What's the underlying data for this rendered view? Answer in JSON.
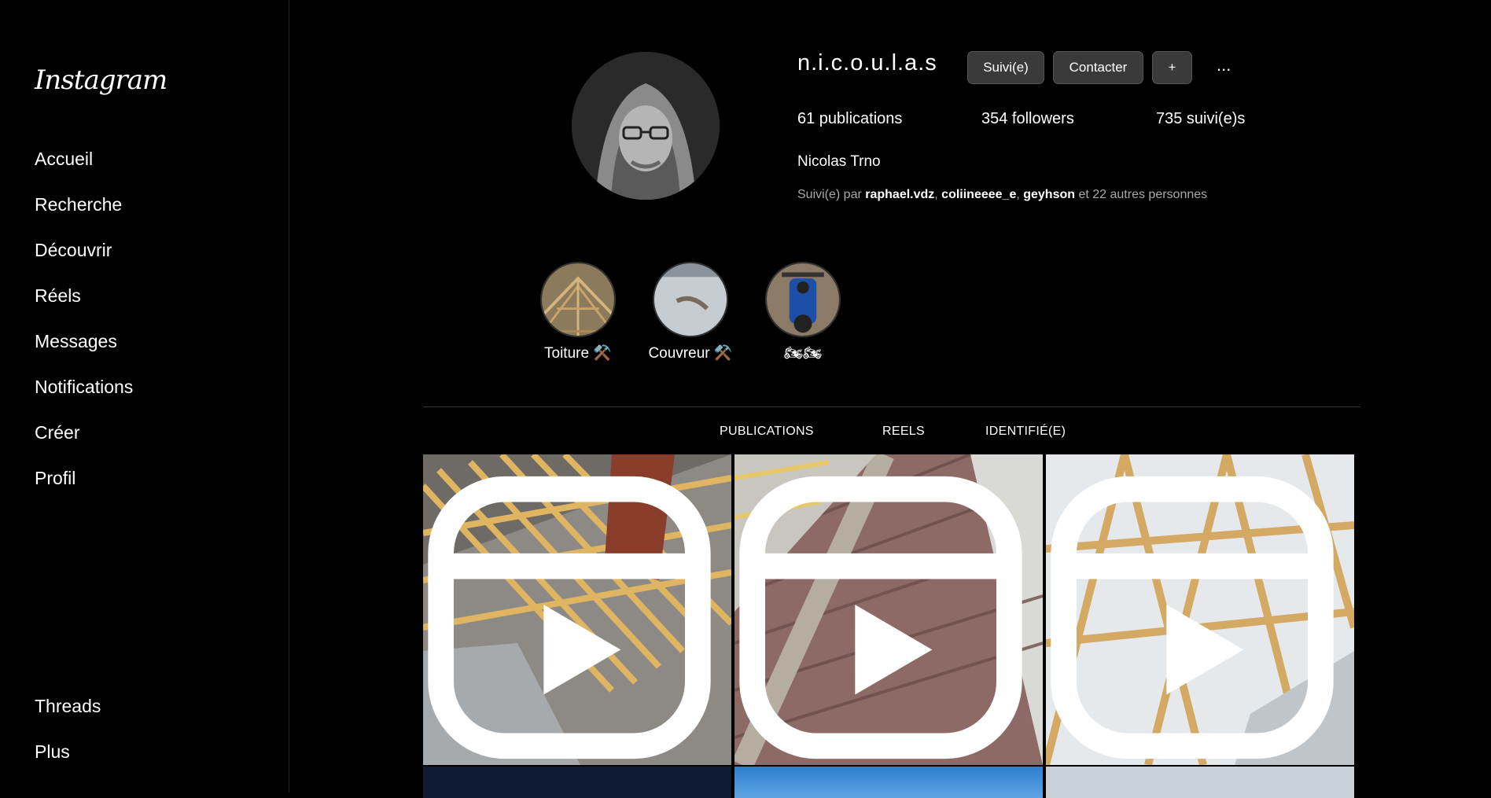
{
  "app": {
    "logo": "Instagram"
  },
  "sidebar": {
    "items": [
      {
        "label": "Accueil"
      },
      {
        "label": "Recherche"
      },
      {
        "label": "Découvrir"
      },
      {
        "label": "Réels"
      },
      {
        "label": "Messages"
      },
      {
        "label": "Notifications"
      },
      {
        "label": "Créer"
      },
      {
        "label": "Profil"
      }
    ],
    "bottom": [
      {
        "label": "Threads"
      },
      {
        "label": "Plus"
      }
    ]
  },
  "profile": {
    "username": "n.i.c.o.u.l.a.s",
    "buttons": {
      "following": "Suivi(e)",
      "contact": "Contacter",
      "add": "+",
      "more": "..."
    },
    "stats": {
      "publications": "61 publications",
      "followers": "354 followers",
      "following": "735 suivi(e)s"
    },
    "full_name": "Nicolas Trno",
    "followed_by": {
      "prefix": "Suivi(e) par ",
      "users": [
        "raphael.vdz",
        "coliineeee_e",
        "geyhson"
      ],
      "suffix": " et 22 autres personnes"
    }
  },
  "highlights": [
    {
      "label": "Toiture ⚒️"
    },
    {
      "label": "Couvreur ⚒️"
    },
    {
      "label": "🏍🏍"
    }
  ],
  "tabs": [
    {
      "label": "PUBLICATIONS"
    },
    {
      "label": "REELS"
    },
    {
      "label": "IDENTIFIÉ(E)"
    }
  ],
  "posts": [
    {
      "icon": "reel-icon"
    },
    {
      "icon": "reel-icon"
    },
    {
      "icon": "reel-icon"
    }
  ]
}
